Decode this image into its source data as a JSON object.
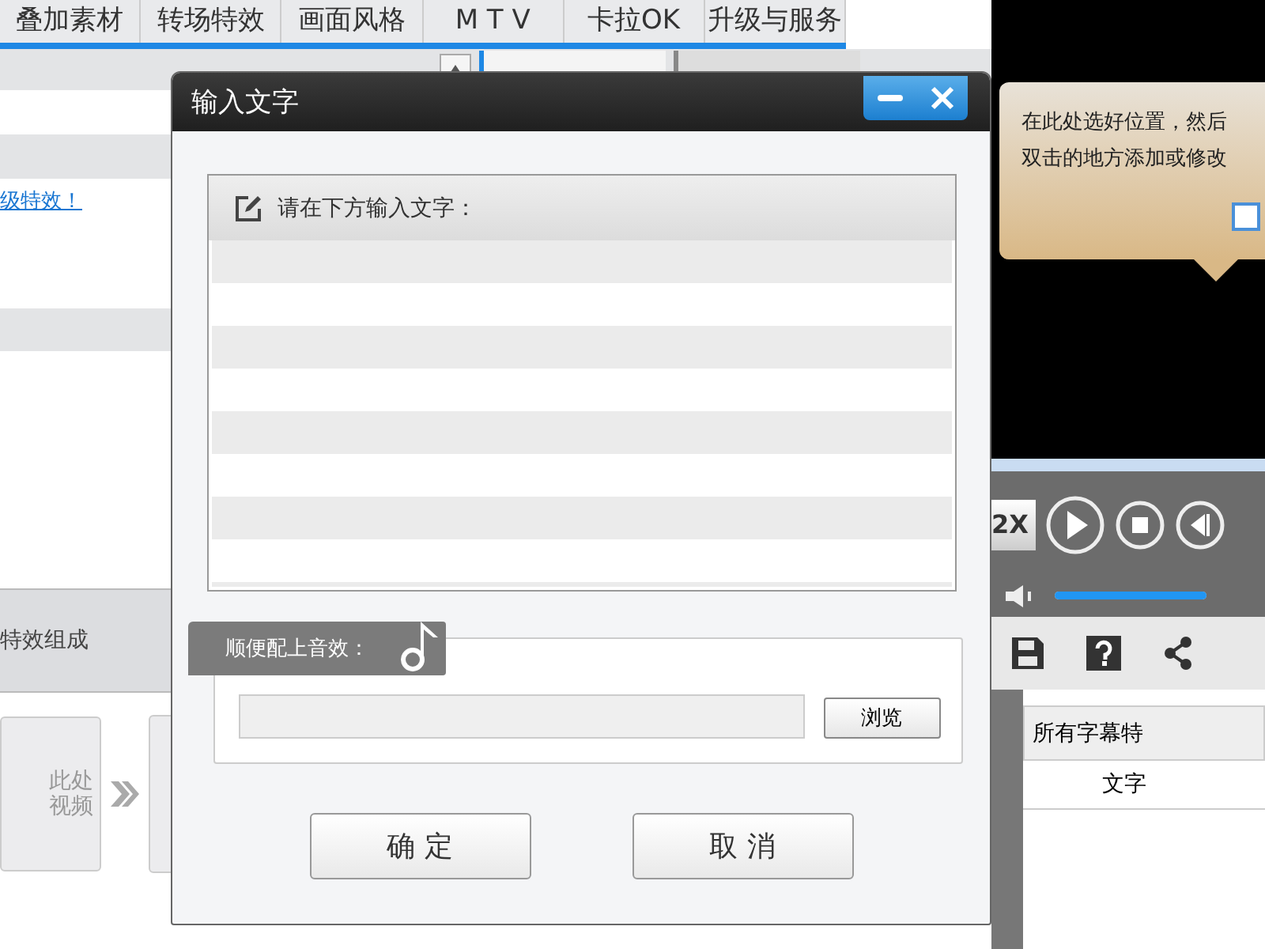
{
  "top_tabs": [
    {
      "label": "叠加素材",
      "selected": false
    },
    {
      "label": "转场特效",
      "selected": false
    },
    {
      "label": "画面风格",
      "selected": false
    },
    {
      "label": "M T V",
      "selected": false
    },
    {
      "label": "卡拉OK",
      "selected": false
    },
    {
      "label": "升级与服务",
      "selected": false
    }
  ],
  "side_tabs": [
    {
      "selected": true
    },
    {
      "selected": false
    }
  ],
  "link": "级特效！",
  "section_title": "特效组成",
  "video_card": {
    "lines": [
      "此处",
      "视频"
    ]
  },
  "tooltip": {
    "lines": [
      "在此处选好位置，然后",
      "双击的地方添加或修改"
    ],
    "checked": false
  },
  "player": {
    "speed": "2X",
    "volume": {
      "level": 1.0
    }
  },
  "subtitle_panel": {
    "title": "所有字幕特",
    "column": "文字"
  },
  "dialog": {
    "title": "输入文字",
    "prompt": "请在下方输入文字：",
    "sound_label": "顺便配上音效：",
    "browse": "浏览",
    "buttons": [
      "确 定",
      "取 消"
    ]
  }
}
